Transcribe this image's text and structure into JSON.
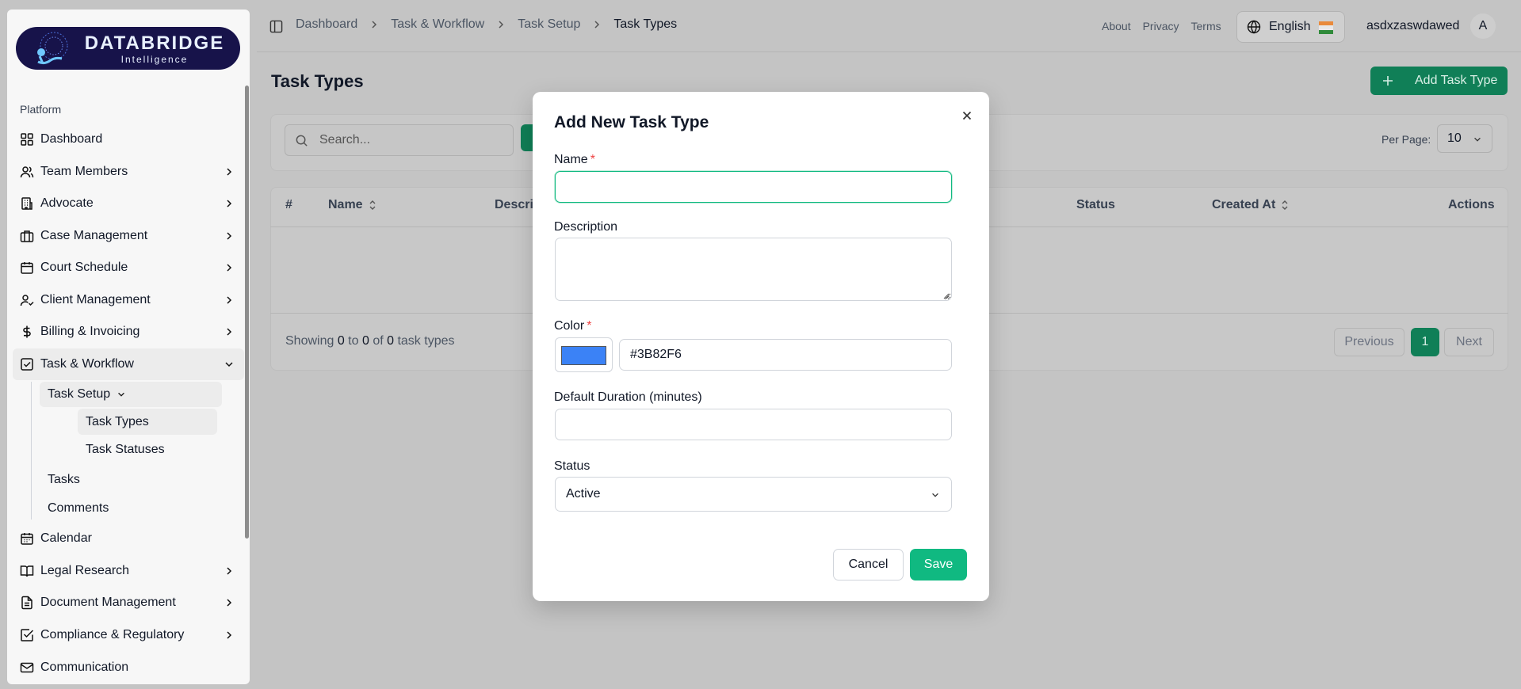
{
  "brand": {
    "title": "DATABRIDGE",
    "subtitle": "Intelligence"
  },
  "sidebar": {
    "group_label": "Platform",
    "items": [
      {
        "label": "Dashboard",
        "icon": "layout-grid-icon"
      },
      {
        "label": "Team Members",
        "icon": "users-icon"
      },
      {
        "label": "Advocate",
        "icon": "building-icon"
      },
      {
        "label": "Case Management",
        "icon": "briefcase-icon"
      },
      {
        "label": "Court Schedule",
        "icon": "calendar-icon"
      },
      {
        "label": "Client Management",
        "icon": "user-check-icon"
      },
      {
        "label": "Billing & Invoicing",
        "icon": "dollar-icon"
      },
      {
        "label": "Task & Workflow",
        "icon": "check-square-icon"
      },
      {
        "label": "Calendar",
        "icon": "calendar-days-icon"
      },
      {
        "label": "Legal Research",
        "icon": "book-open-icon"
      },
      {
        "label": "Document Management",
        "icon": "file-text-icon"
      },
      {
        "label": "Compliance & Regulatory",
        "icon": "check-square-icon"
      },
      {
        "label": "Communication",
        "icon": "mail-icon"
      }
    ],
    "task_workflow": {
      "task_setup": "Task Setup",
      "task_types": "Task Types",
      "task_statuses": "Task Statuses",
      "tasks": "Tasks",
      "comments": "Comments"
    }
  },
  "breadcrumb": [
    "Dashboard",
    "Task & Workflow",
    "Task Setup",
    "Task Types"
  ],
  "toplinks": [
    "About",
    "Privacy",
    "Terms"
  ],
  "language": "English",
  "user": {
    "name": "asdxzaswdawed",
    "initial": "A"
  },
  "page": {
    "title": "Task Types",
    "add_button": "Add Task Type",
    "search_placeholder": "Search...",
    "per_page_label": "Per Page:",
    "per_page_value": "10",
    "columns": [
      "#",
      "Name",
      "Descri",
      "Status",
      "Created At",
      "Actions"
    ],
    "showing": {
      "prefix": "Showing ",
      "from": "0",
      "to_word": " to ",
      "to": "0",
      "of_word": " of ",
      "total": "0",
      "suffix": " task types"
    },
    "pager": {
      "previous": "Previous",
      "current": "1",
      "next": "Next"
    }
  },
  "modal": {
    "title": "Add New Task Type",
    "name_label": "Name",
    "name_value": "",
    "description_label": "Description",
    "color_label": "Color",
    "color_value": "#3B82F6",
    "duration_label": "Default Duration (minutes)",
    "status_label": "Status",
    "status_value": "Active",
    "required_mark": "*",
    "cancel": "Cancel",
    "save": "Save"
  },
  "colors": {
    "accent": "#10b981",
    "accent_dim": "#107f57",
    "swatch": "#3B82F6",
    "required": "#ef4444"
  }
}
